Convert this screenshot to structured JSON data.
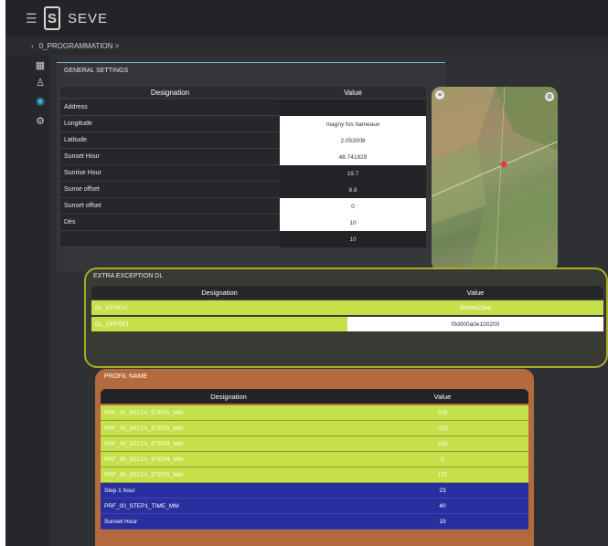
{
  "app": {
    "title": "SEVE"
  },
  "breadcrumb": {
    "path": "0_PROGRAMMATION >"
  },
  "general_settings": {
    "title": "GENERAL SETTINGS",
    "col_designation": "Designation",
    "col_value": "Value",
    "rows": [
      {
        "label": "Address",
        "value": ""
      },
      {
        "label": "Longitude",
        "value": "magny fos hameaux"
      },
      {
        "label": "Latitude",
        "value": "2.053008"
      },
      {
        "label": "Sunset Hour",
        "value": "48.741829"
      },
      {
        "label": "Sunrise Hour",
        "value": "19.7"
      },
      {
        "label": "Sunse offset",
        "value": "8.8"
      },
      {
        "label": "Sunset offset",
        "value": "0"
      },
      {
        "label": "Dés",
        "value": "10"
      },
      {
        "label": "",
        "value": "10"
      }
    ]
  },
  "extra_exception": {
    "title": "EXTRA EXCEPTION DL",
    "col_designation": "Designation",
    "col_value": "Value",
    "rows": [
      {
        "label": "DL_EPOCH",
        "value": "5f0d4e23e4"
      },
      {
        "label": "DL_OFFSET",
        "value": "f0d000a0e100200"
      }
    ]
  },
  "profile": {
    "title": "PROFIL NAME",
    "col_designation": "Designation",
    "col_value": "Value",
    "rows": [
      {
        "label": "PRF_00_DELTA_STEP1_MM",
        "value": "215",
        "style": "yellow"
      },
      {
        "label": "PRF_00_DELTA_STEP2_MM",
        "value": "-120",
        "style": "yellow"
      },
      {
        "label": "PRF_00_DELTA_STEP3_MM",
        "value": "220",
        "style": "yellow"
      },
      {
        "label": "PRF_00_DELTA_STEP4_MM",
        "value": "0",
        "style": "yellow"
      },
      {
        "label": "PRF_00_DELTA_STEP5_MM",
        "value": "175",
        "style": "yellow"
      },
      {
        "label": "Step 1 hour",
        "value": "23",
        "style": "blue"
      },
      {
        "label": "PRF_00_STEP1_TIME_MM",
        "value": "40",
        "style": "blue"
      },
      {
        "label": "Sunset Hour",
        "value": "19",
        "style": "blue"
      }
    ]
  },
  "colors": {
    "accent": "#3fb7e6",
    "yellow_row": "#c6e04a",
    "blue_row": "#2a2fa0",
    "ext_border": "#a8ab2e",
    "profile_frame": "#b36a3c"
  }
}
